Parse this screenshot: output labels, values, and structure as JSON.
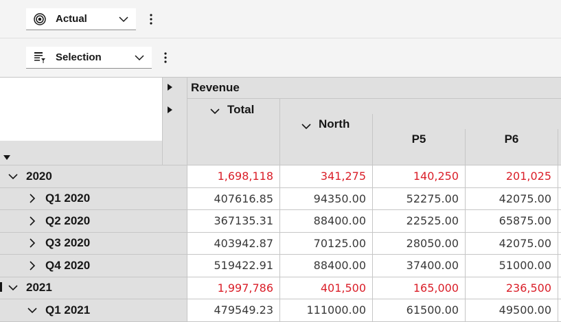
{
  "toolbar1": {
    "dropdown_label": "Actual",
    "icon": "target-icon"
  },
  "toolbar2": {
    "dropdown_label": "Selection",
    "icon": "selection-list-icon"
  },
  "columns": {
    "measure": "Revenue",
    "total": "Total",
    "north": "North",
    "p5": "P5",
    "p6": "P6"
  },
  "rows": [
    {
      "label": "2020",
      "level": 0,
      "expanded": true,
      "type": "total",
      "values": [
        "1,698,118",
        "341,275",
        "140,250",
        "201,025"
      ]
    },
    {
      "label": "Q1 2020",
      "level": 1,
      "expanded": false,
      "type": "detail",
      "values": [
        "407616.85",
        "94350.00",
        "52275.00",
        "42075.00"
      ]
    },
    {
      "label": "Q2 2020",
      "level": 1,
      "expanded": false,
      "type": "detail",
      "values": [
        "367135.31",
        "88400.00",
        "22525.00",
        "65875.00"
      ]
    },
    {
      "label": "Q3 2020",
      "level": 1,
      "expanded": false,
      "type": "detail",
      "values": [
        "403942.87",
        "70125.00",
        "28050.00",
        "42075.00"
      ]
    },
    {
      "label": "Q4 2020",
      "level": 1,
      "expanded": false,
      "type": "detail",
      "values": [
        "519422.91",
        "88400.00",
        "37400.00",
        "51000.00"
      ]
    },
    {
      "label": "2021",
      "level": 0,
      "expanded": true,
      "type": "total",
      "values": [
        "1,997,786",
        "401,500",
        "165,000",
        "236,500"
      ]
    },
    {
      "label": "Q1 2021",
      "level": 1,
      "expanded": true,
      "type": "detail",
      "values": [
        "479549.23",
        "111000.00",
        "61500.00",
        "49500.00"
      ]
    }
  ],
  "colors": {
    "total_value": "#da1e28",
    "detail_value": "#393939"
  }
}
